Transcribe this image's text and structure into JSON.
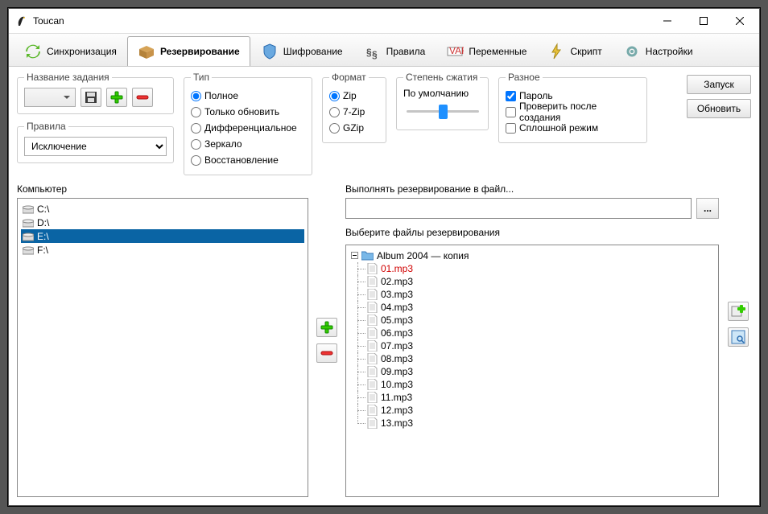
{
  "window": {
    "title": "Toucan"
  },
  "tabs": [
    {
      "label": "Синхронизация"
    },
    {
      "label": "Резервирование"
    },
    {
      "label": "Шифрование"
    },
    {
      "label": "Правила"
    },
    {
      "label": "Переменные"
    },
    {
      "label": "Скрипт"
    },
    {
      "label": "Настройки"
    }
  ],
  "groups": {
    "jobname": "Название задания",
    "rules": "Правила",
    "rules_value": "Исключение",
    "type": "Тип",
    "type_options": [
      "Полное",
      "Только обновить",
      "Дифференциальное",
      "Зеркало",
      "Восстановление"
    ],
    "format": "Формат",
    "format_options": [
      "Zip",
      "7-Zip",
      "GZip"
    ],
    "compress": "Степень сжатия",
    "compress_value": "По умолчанию",
    "misc": "Разное",
    "misc_options": [
      "Пароль",
      "Проверить после создания",
      "Сплошной режим"
    ]
  },
  "buttons": {
    "run": "Запуск",
    "refresh": "Обновить",
    "browse": "..."
  },
  "labels": {
    "computer": "Компьютер",
    "dest": "Выполнять резервирование в файл...",
    "select_files": "Выберите файлы резервирования"
  },
  "drives": [
    "C:\\",
    "D:\\",
    "E:\\",
    "F:\\"
  ],
  "drive_selected": 2,
  "folder": "Album 2004 — копия",
  "files": [
    "01.mp3",
    "02.mp3",
    "03.mp3",
    "04.mp3",
    "05.mp3",
    "06.mp3",
    "07.mp3",
    "08.mp3",
    "09.mp3",
    "10.mp3",
    "11.mp3",
    "12.mp3",
    "13.mp3"
  ]
}
